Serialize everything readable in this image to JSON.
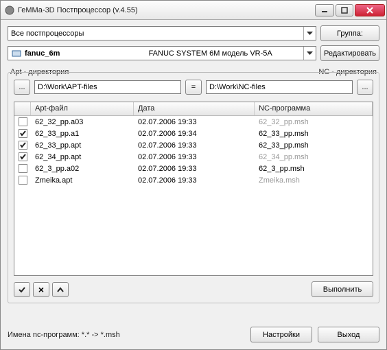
{
  "window": {
    "title": "ГеММа-3D Постпроцессор (v.4.55)"
  },
  "top": {
    "filter": "Все постпроцессоры",
    "group_btn": "Группа:",
    "pp_name": "fanuc_6m",
    "pp_desc": "FANUC SYSTEM 6M модель VR-5A",
    "edit_btn": "Редактировать"
  },
  "dirs": {
    "apt_label": "Apt - директория",
    "nc_label": "NC - директория",
    "apt_path": "D:\\Work\\APT-files",
    "nc_path": "D:\\Work\\NC-files",
    "browse": "...",
    "eq": "="
  },
  "table": {
    "h_apt": "Apt-файл",
    "h_date": "Дата",
    "h_nc": "NC-программа",
    "rows": [
      {
        "chk": false,
        "apt": "62_32_pp.a03",
        "date": "02.07.2006  19:33",
        "nc": "62_32_pp.msh",
        "dim": true
      },
      {
        "chk": true,
        "apt": "62_33_pp.a1",
        "date": "02.07.2006  19:34",
        "nc": "62_33_pp.msh",
        "dim": false
      },
      {
        "chk": true,
        "apt": "62_33_pp.apt",
        "date": "02.07.2006  19:33",
        "nc": "62_33_pp.msh",
        "dim": false
      },
      {
        "chk": true,
        "apt": "62_34_pp.apt",
        "date": "02.07.2006  19:33",
        "nc": "62_34_pp.msh",
        "dim": true
      },
      {
        "chk": false,
        "apt": "62_3_pp.a02",
        "date": "02.07.2006  19:33",
        "nc": "62_3_pp.msh",
        "dim": false
      },
      {
        "chk": false,
        "apt": "Zmeika.apt",
        "date": "02.07.2006  19:33",
        "nc": "Zmeika.msh",
        "dim": true
      }
    ]
  },
  "actions": {
    "check": "✓",
    "cross": "×",
    "up": "⌃",
    "run": "Выполнить"
  },
  "footer": {
    "label": "Имена nc-программ:   *.* -> *.msh",
    "settings": "Настройки",
    "exit": "Выход"
  }
}
